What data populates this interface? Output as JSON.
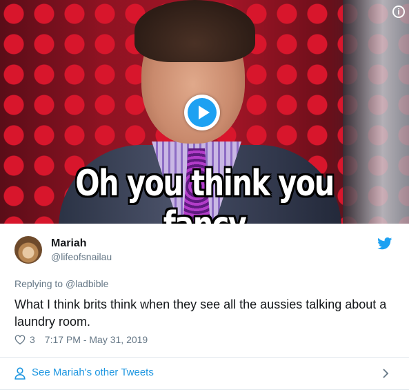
{
  "media": {
    "caption": "Oh you think you fancy",
    "info_icon": "i"
  },
  "author": {
    "name": "Mariah",
    "handle": "@lifeofsnailau"
  },
  "tweet": {
    "reply_prefix": "Replying to",
    "reply_handle": "@ladbible",
    "text": "What I think brits think when they see all the aussies talking about a laundry room.",
    "likes": "3",
    "timestamp": "7:17 PM - May 31, 2019"
  },
  "footer": {
    "label": "See Mariah's other Tweets"
  },
  "colors": {
    "accent": "#1da1f2",
    "link": "#1b95e0",
    "text": "#14171a",
    "muted": "#657786"
  }
}
